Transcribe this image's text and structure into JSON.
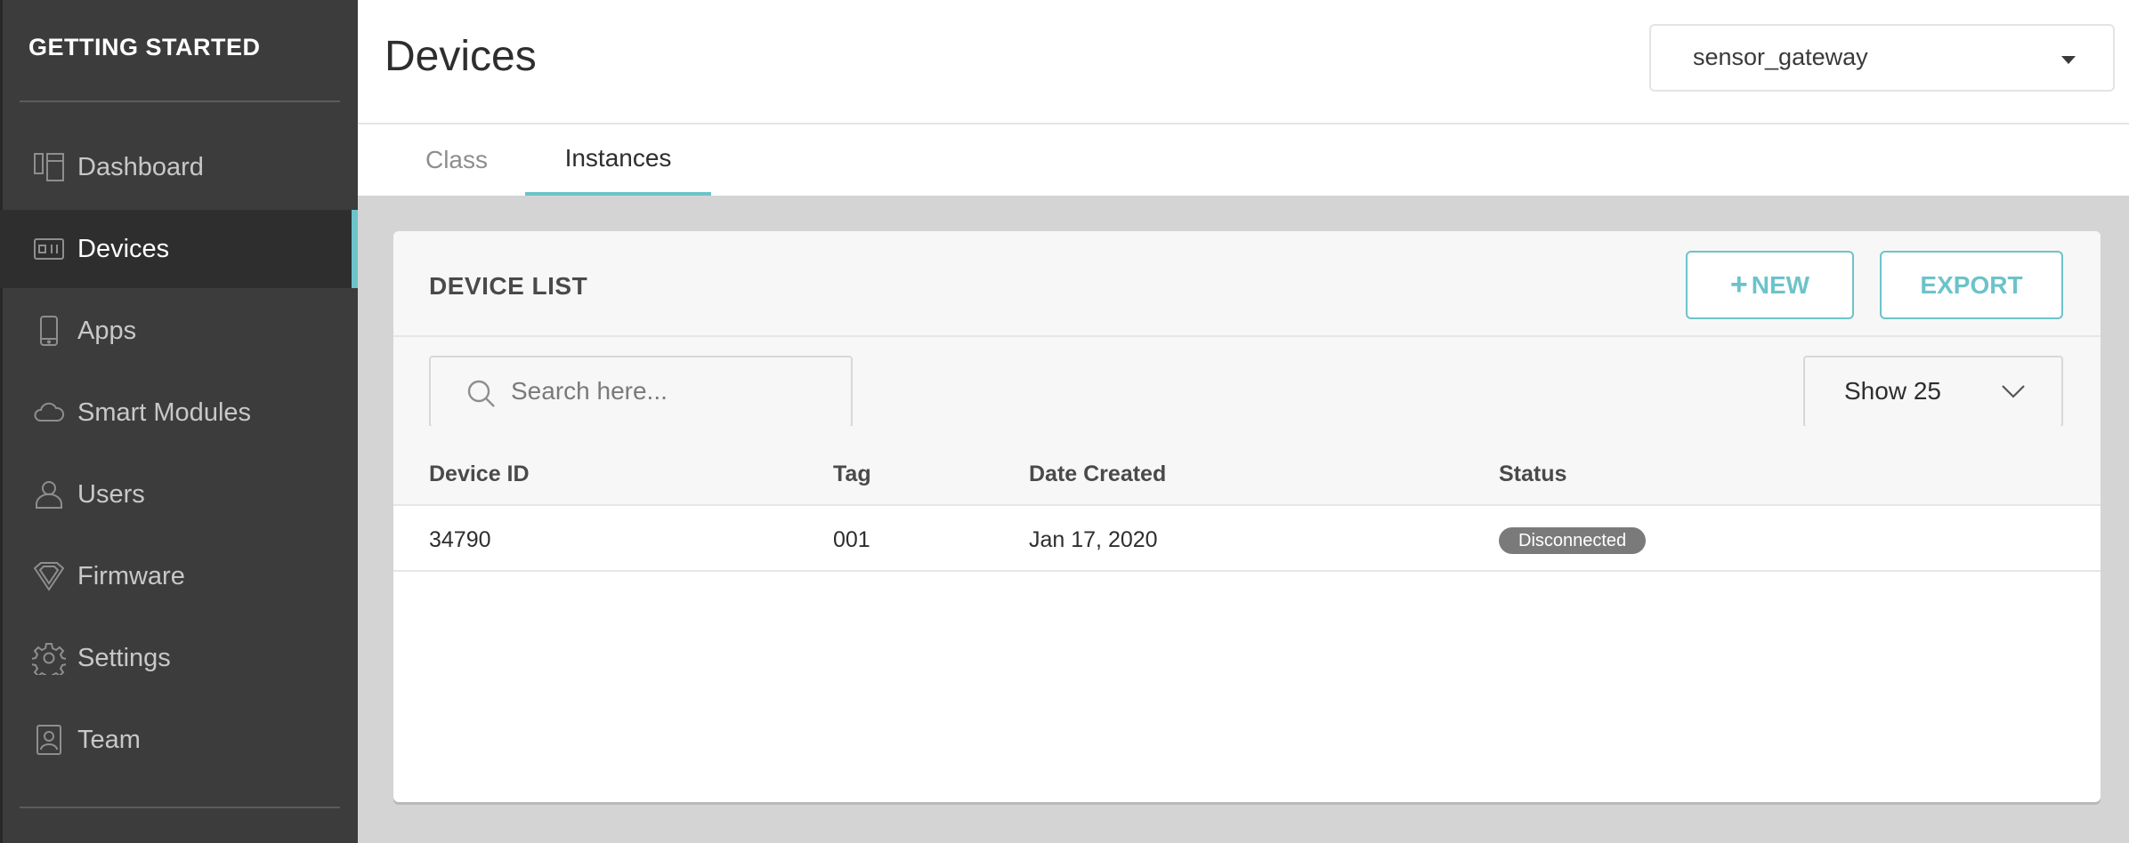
{
  "sidebar": {
    "title": "GETTING STARTED",
    "items": [
      {
        "label": "Dashboard",
        "icon": "dashboard-icon"
      },
      {
        "label": "Devices",
        "icon": "devices-icon",
        "active": true
      },
      {
        "label": "Apps",
        "icon": "phone-icon"
      },
      {
        "label": "Smart Modules",
        "icon": "cloud-icon"
      },
      {
        "label": "Users",
        "icon": "user-icon"
      },
      {
        "label": "Firmware",
        "icon": "firmware-icon"
      },
      {
        "label": "Settings",
        "icon": "gear-icon"
      },
      {
        "label": "Team",
        "icon": "team-icon"
      }
    ]
  },
  "header": {
    "title": "Devices",
    "app_select": {
      "value": "sensor_gateway"
    }
  },
  "tabs": [
    {
      "label": "Class",
      "active": false
    },
    {
      "label": "Instances",
      "active": true
    }
  ],
  "device_list": {
    "title": "DEVICE LIST",
    "new_label": "NEW",
    "export_label": "EXPORT",
    "search_placeholder": "Search here...",
    "show_label": "Show 25",
    "columns": [
      "Device ID",
      "Tag",
      "Date Created",
      "Status"
    ],
    "rows": [
      {
        "device_id": "34790",
        "tag": "001",
        "date_created": "Jan 17, 2020",
        "status": "Disconnected"
      }
    ]
  },
  "colors": {
    "accent": "#6cc3c9",
    "sidebar_bg": "#3b3c3b",
    "status_badge": "#7a7a7a"
  }
}
